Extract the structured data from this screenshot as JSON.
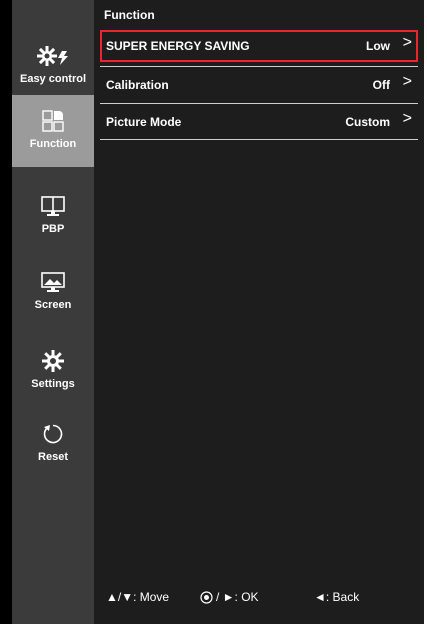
{
  "sidebar": {
    "items": [
      {
        "label": "Easy control",
        "icon": "easy-control-icon"
      },
      {
        "label": "Function",
        "icon": "function-icon"
      },
      {
        "label": "PBP",
        "icon": "pbp-icon"
      },
      {
        "label": "Screen",
        "icon": "screen-icon"
      },
      {
        "label": "Settings",
        "icon": "settings-icon"
      },
      {
        "label": "Reset",
        "icon": "reset-icon"
      }
    ],
    "active": "Function"
  },
  "main": {
    "title": "Function",
    "rows": [
      {
        "name": "SUPER ENERGY SAVING",
        "value": "Low",
        "chevron": ">"
      },
      {
        "name": "Calibration",
        "value": "Off",
        "chevron": ">"
      },
      {
        "name": "Picture Mode",
        "value": "Custom",
        "chevron": ">"
      }
    ]
  },
  "footer": {
    "move": "▲/▼: Move",
    "ok": "/ ►: OK",
    "back": "◄: Back"
  },
  "colors": {
    "sidebar_bg": "#3b3b3b",
    "sidebar_active": "#9b9b9b",
    "main_bg": "#1d1d1d",
    "selection_border": "#e8262b"
  }
}
